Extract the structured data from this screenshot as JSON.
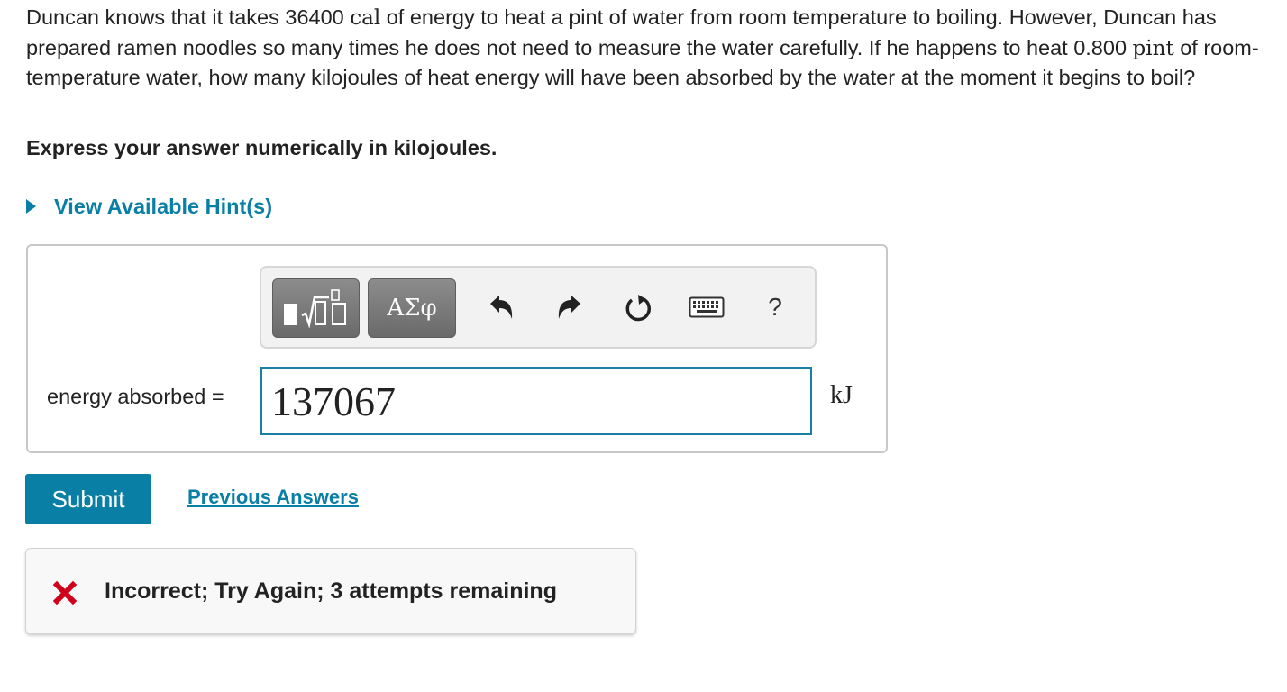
{
  "question": {
    "part1": "Duncan knows that it takes 36400 ",
    "unit_cal": "cal",
    "part2": " of energy to heat a pint of water from room temperature to boiling. However, Duncan has prepared ramen noodles so many times he does not need to measure the water carefully. If he happens to heat 0.800 ",
    "unit_pint": "pint",
    "part3": " of room-temperature water, how many kilojoules of heat energy will have been absorbed by the water at the moment it begins to boil?"
  },
  "instruction": "Express your answer numerically in kilojoules.",
  "hint_label": "View Available Hint(s)",
  "toolbar": {
    "symbols_label": "ΑΣφ",
    "help_label": "?"
  },
  "answer": {
    "label": "energy absorbed =",
    "value": "137067",
    "unit": "kJ"
  },
  "submit_label": "Submit",
  "previous_answers_label": "Previous Answers",
  "feedback": {
    "message": "Incorrect; Try Again; 3 attempts remaining",
    "status_color": "#d0021b"
  },
  "colors": {
    "accent": "#0a7fa5",
    "toolbar_button": "#7a7a7a"
  },
  "icons": [
    "templates-icon",
    "undo-icon",
    "redo-icon",
    "reset-icon",
    "keyboard-icon",
    "help-icon",
    "incorrect-x-icon",
    "hint-expand-arrow-icon"
  ]
}
